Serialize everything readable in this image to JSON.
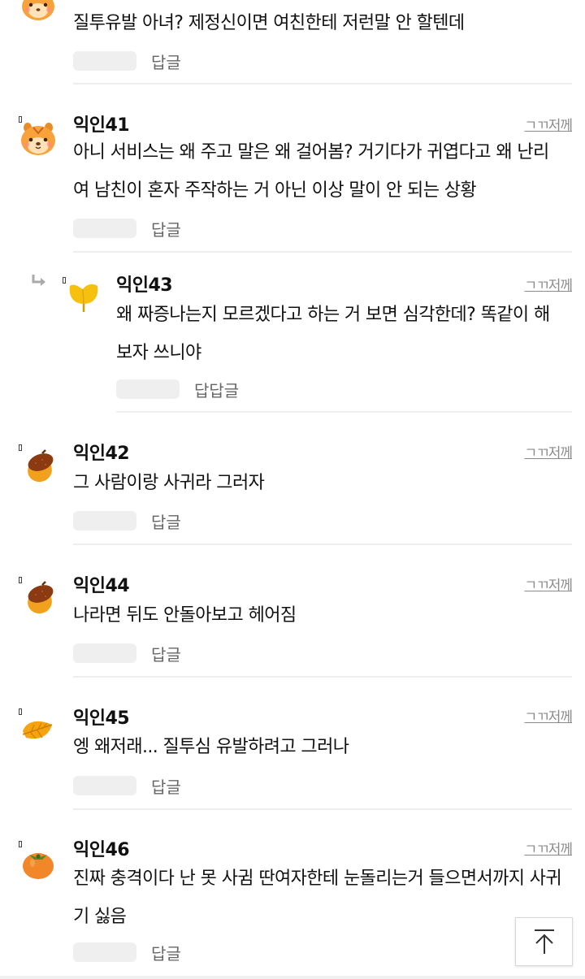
{
  "comments": [
    {
      "nick": "",
      "time": "",
      "text": "질투유발 아녀? 제정신이면 여친한테 저런말 안 할텐데",
      "reply": "답글",
      "avatar": "squirrel"
    },
    {
      "nick": "익인41",
      "time": "ㄱㄲ저께",
      "text": "아니 서비스는 왜 주고 말은 왜 걸어봄? 거기다가 귀엽다고 왜 난리여 남친이 혼자 주작하는 거 아닌 이상 말이 안 되는 상황",
      "reply": "답글",
      "avatar": "squirrel"
    },
    {
      "nick": "익인43",
      "time": "ㄱㄲ저께",
      "text": "왜 짜증나는지 모르겠다고 하는 거 보면 심각한데? 똑같이 해보자 쓰니야",
      "reply": "답답글",
      "avatar": "ginkgo-leaf"
    },
    {
      "nick": "익인42",
      "time": "ㄱㄲ저께",
      "text": "그 사람이랑 사귀라 그러자",
      "reply": "답글",
      "avatar": "acorn"
    },
    {
      "nick": "익인44",
      "time": "ㄱㄲ저께",
      "text": "나라면 뒤도 안돌아보고 헤어짐",
      "reply": "답글",
      "avatar": "acorn"
    },
    {
      "nick": "익인45",
      "time": "ㄱㄲ저께",
      "text": "엥 왜저래... 질투심 유발하려고 그러나",
      "reply": "답글",
      "avatar": "autumn-leaf"
    },
    {
      "nick": "익인46",
      "time": "ㄱㄲ저께",
      "text": "진짜 충격이다 난 못 사귐 딴여자한테 눈돌리는거 들으면서까지 사귀기 싫음",
      "reply": "답글",
      "avatar": "persimmon"
    }
  ],
  "icons": {
    "reply_arrow": "reply-arrow-icon",
    "scroll_top": "scroll-to-top-icon"
  },
  "colors": {
    "text": "#111111",
    "muted": "#8a8a8a",
    "pill": "#efefef",
    "divider": "#eeeeee"
  }
}
